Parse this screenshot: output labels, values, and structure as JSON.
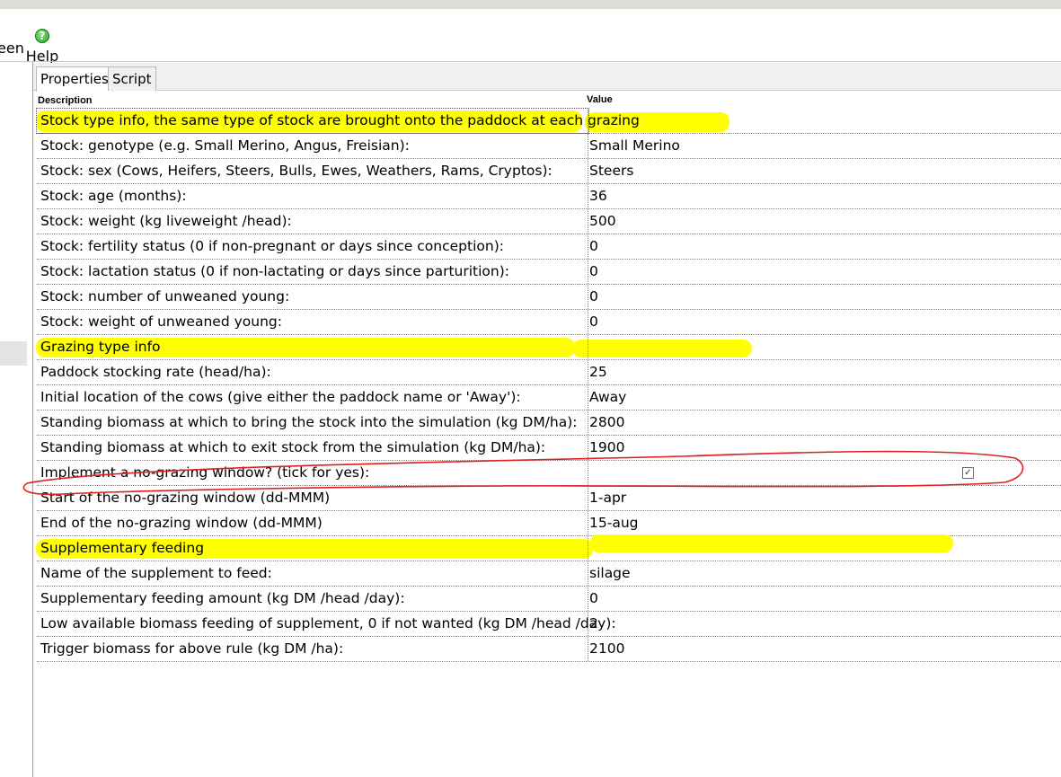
{
  "menu": {
    "screen_label": "een",
    "help_label": "Help",
    "help_icon": "help-icon"
  },
  "tabs": [
    "Properties",
    "Script"
  ],
  "columns": {
    "description": "Description",
    "value": "Value"
  },
  "rows": [
    {
      "desc": "Stock type info, the same type of stock are brought onto the paddock at each grazing",
      "value": "",
      "heading": true
    },
    {
      "desc": "Stock: genotype (e.g. Small Merino, Angus, Freisian):",
      "value": "Small Merino"
    },
    {
      "desc": "Stock: sex (Cows, Heifers, Steers, Bulls, Ewes, Weathers, Rams, Cryptos):",
      "value": "Steers"
    },
    {
      "desc": "Stock: age (months):",
      "value": "36"
    },
    {
      "desc": "Stock: weight (kg liveweight /head):",
      "value": "500"
    },
    {
      "desc": "Stock: fertility status (0 if non-pregnant or days since conception):",
      "value": "0"
    },
    {
      "desc": "Stock: lactation status (0 if non-lactating or days since parturition):",
      "value": "0"
    },
    {
      "desc": "Stock: number of unweaned young:",
      "value": "0"
    },
    {
      "desc": "Stock: weight of unweaned young:",
      "value": "0"
    },
    {
      "desc": "Grazing type info",
      "value": "",
      "heading": true
    },
    {
      "desc": "Paddock stocking rate (head/ha):",
      "value": "25"
    },
    {
      "desc": "Initial location of the cows (give either the paddock name or 'Away'):",
      "value": "Away"
    },
    {
      "desc": "Standing biomass at which to bring the stock into the simulation (kg DM/ha):",
      "value": "2800"
    },
    {
      "desc": "Standing biomass at which to exit  stock from the simulation (kg DM/ha):",
      "value": "1900"
    },
    {
      "desc": "Implement a no-grazing window? (tick for yes):",
      "value": "",
      "checkbox": true,
      "checked": true
    },
    {
      "desc": "Start of the no-grazing window (dd-MMM)",
      "value": "1-apr"
    },
    {
      "desc": "End of the no-grazing window (dd-MMM)",
      "value": "15-aug"
    },
    {
      "desc": "Supplementary feeding",
      "value": "",
      "heading": true
    },
    {
      "desc": "Name of the supplement to feed:",
      "value": "silage"
    },
    {
      "desc": "Supplementary feeding amount (kg DM /head /day):",
      "value": "0"
    },
    {
      "desc": "Low available biomass feeding of supplement, 0 if not wanted (kg DM /head /day):",
      "value": "2"
    },
    {
      "desc": "Trigger biomass for above rule (kg DM /ha):",
      "value": "2100"
    }
  ],
  "annotations": {
    "highlight_color": "#ffff00",
    "ink_color": "#e02020"
  }
}
